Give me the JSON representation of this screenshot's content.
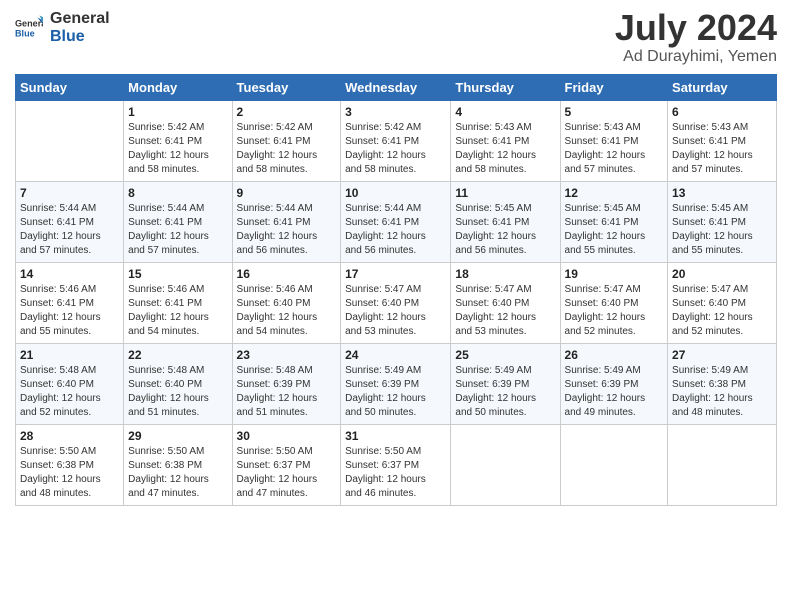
{
  "header": {
    "logo_line1": "General",
    "logo_line2": "Blue",
    "month": "July 2024",
    "location": "Ad Durayhimi, Yemen"
  },
  "days_of_week": [
    "Sunday",
    "Monday",
    "Tuesday",
    "Wednesday",
    "Thursday",
    "Friday",
    "Saturday"
  ],
  "weeks": [
    [
      {
        "day": "",
        "info": ""
      },
      {
        "day": "1",
        "info": "Sunrise: 5:42 AM\nSunset: 6:41 PM\nDaylight: 12 hours\nand 58 minutes."
      },
      {
        "day": "2",
        "info": "Sunrise: 5:42 AM\nSunset: 6:41 PM\nDaylight: 12 hours\nand 58 minutes."
      },
      {
        "day": "3",
        "info": "Sunrise: 5:42 AM\nSunset: 6:41 PM\nDaylight: 12 hours\nand 58 minutes."
      },
      {
        "day": "4",
        "info": "Sunrise: 5:43 AM\nSunset: 6:41 PM\nDaylight: 12 hours\nand 58 minutes."
      },
      {
        "day": "5",
        "info": "Sunrise: 5:43 AM\nSunset: 6:41 PM\nDaylight: 12 hours\nand 57 minutes."
      },
      {
        "day": "6",
        "info": "Sunrise: 5:43 AM\nSunset: 6:41 PM\nDaylight: 12 hours\nand 57 minutes."
      }
    ],
    [
      {
        "day": "7",
        "info": "Sunrise: 5:44 AM\nSunset: 6:41 PM\nDaylight: 12 hours\nand 57 minutes."
      },
      {
        "day": "8",
        "info": "Sunrise: 5:44 AM\nSunset: 6:41 PM\nDaylight: 12 hours\nand 57 minutes."
      },
      {
        "day": "9",
        "info": "Sunrise: 5:44 AM\nSunset: 6:41 PM\nDaylight: 12 hours\nand 56 minutes."
      },
      {
        "day": "10",
        "info": "Sunrise: 5:44 AM\nSunset: 6:41 PM\nDaylight: 12 hours\nand 56 minutes."
      },
      {
        "day": "11",
        "info": "Sunrise: 5:45 AM\nSunset: 6:41 PM\nDaylight: 12 hours\nand 56 minutes."
      },
      {
        "day": "12",
        "info": "Sunrise: 5:45 AM\nSunset: 6:41 PM\nDaylight: 12 hours\nand 55 minutes."
      },
      {
        "day": "13",
        "info": "Sunrise: 5:45 AM\nSunset: 6:41 PM\nDaylight: 12 hours\nand 55 minutes."
      }
    ],
    [
      {
        "day": "14",
        "info": "Sunrise: 5:46 AM\nSunset: 6:41 PM\nDaylight: 12 hours\nand 55 minutes."
      },
      {
        "day": "15",
        "info": "Sunrise: 5:46 AM\nSunset: 6:41 PM\nDaylight: 12 hours\nand 54 minutes."
      },
      {
        "day": "16",
        "info": "Sunrise: 5:46 AM\nSunset: 6:40 PM\nDaylight: 12 hours\nand 54 minutes."
      },
      {
        "day": "17",
        "info": "Sunrise: 5:47 AM\nSunset: 6:40 PM\nDaylight: 12 hours\nand 53 minutes."
      },
      {
        "day": "18",
        "info": "Sunrise: 5:47 AM\nSunset: 6:40 PM\nDaylight: 12 hours\nand 53 minutes."
      },
      {
        "day": "19",
        "info": "Sunrise: 5:47 AM\nSunset: 6:40 PM\nDaylight: 12 hours\nand 52 minutes."
      },
      {
        "day": "20",
        "info": "Sunrise: 5:47 AM\nSunset: 6:40 PM\nDaylight: 12 hours\nand 52 minutes."
      }
    ],
    [
      {
        "day": "21",
        "info": "Sunrise: 5:48 AM\nSunset: 6:40 PM\nDaylight: 12 hours\nand 52 minutes."
      },
      {
        "day": "22",
        "info": "Sunrise: 5:48 AM\nSunset: 6:40 PM\nDaylight: 12 hours\nand 51 minutes."
      },
      {
        "day": "23",
        "info": "Sunrise: 5:48 AM\nSunset: 6:39 PM\nDaylight: 12 hours\nand 51 minutes."
      },
      {
        "day": "24",
        "info": "Sunrise: 5:49 AM\nSunset: 6:39 PM\nDaylight: 12 hours\nand 50 minutes."
      },
      {
        "day": "25",
        "info": "Sunrise: 5:49 AM\nSunset: 6:39 PM\nDaylight: 12 hours\nand 50 minutes."
      },
      {
        "day": "26",
        "info": "Sunrise: 5:49 AM\nSunset: 6:39 PM\nDaylight: 12 hours\nand 49 minutes."
      },
      {
        "day": "27",
        "info": "Sunrise: 5:49 AM\nSunset: 6:38 PM\nDaylight: 12 hours\nand 48 minutes."
      }
    ],
    [
      {
        "day": "28",
        "info": "Sunrise: 5:50 AM\nSunset: 6:38 PM\nDaylight: 12 hours\nand 48 minutes."
      },
      {
        "day": "29",
        "info": "Sunrise: 5:50 AM\nSunset: 6:38 PM\nDaylight: 12 hours\nand 47 minutes."
      },
      {
        "day": "30",
        "info": "Sunrise: 5:50 AM\nSunset: 6:37 PM\nDaylight: 12 hours\nand 47 minutes."
      },
      {
        "day": "31",
        "info": "Sunrise: 5:50 AM\nSunset: 6:37 PM\nDaylight: 12 hours\nand 46 minutes."
      },
      {
        "day": "",
        "info": ""
      },
      {
        "day": "",
        "info": ""
      },
      {
        "day": "",
        "info": ""
      }
    ]
  ]
}
